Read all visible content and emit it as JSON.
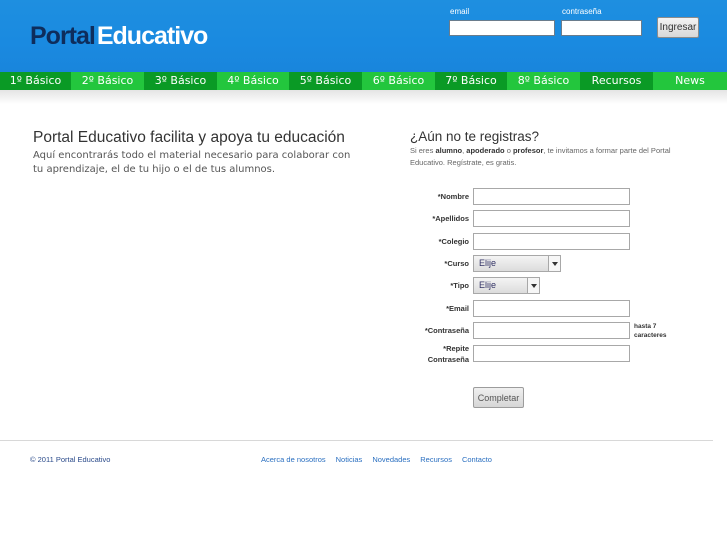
{
  "header": {
    "logo_part1": "Portal",
    "logo_part2": "Educativo",
    "email_label": "email",
    "password_label": "contraseña",
    "login_button": "Ingresar"
  },
  "nav": {
    "items": [
      {
        "label": "1º Básico"
      },
      {
        "label": "2º Básico"
      },
      {
        "label": "3º Básico"
      },
      {
        "label": "4º Básico"
      },
      {
        "label": "5º Básico"
      },
      {
        "label": "6º Básico"
      },
      {
        "label": "7º Básico"
      },
      {
        "label": "8º Básico"
      },
      {
        "label": "Recursos"
      },
      {
        "label": "News"
      }
    ]
  },
  "intro": {
    "title": "Portal Educativo facilita y apoya tu educación",
    "text": "Aquí encontrarás todo el material necesario para colaborar con tu aprendizaje, el de tu hijo o el de tus alumnos."
  },
  "register": {
    "title": "¿Aún no te registras?",
    "text_prefix": "Si eres ",
    "role1": "alumno",
    "sep1": ", ",
    "role2": "apoderado",
    "sep2": " o ",
    "role3": "profesor",
    "text_suffix": ", te invitamos a formar parte del Portal Educativo. Regístrate, es gratis.",
    "fields": {
      "nombre": "*Nombre",
      "apellidos": "*Apellidos",
      "colegio": "*Colegio",
      "curso": "*Curso",
      "tipo": "*Tipo",
      "email": "*Email",
      "contrasena": "*Contraseña",
      "repite": "*Repite Contraseña"
    },
    "curso_value": "Elije",
    "tipo_value": "Elije",
    "password_hint": "hasta 7 caracteres",
    "submit": "Completar"
  },
  "footer": {
    "copyright": "© 2011 Portal Educativo",
    "links": [
      "Acerca de nosotros",
      "Noticias",
      "Novedades",
      "Recursos",
      "Contacto"
    ]
  },
  "colors": {
    "header_blue": "#1a8ae0",
    "nav_green_light": "#23c63d",
    "nav_green_dark": "#0a9a25",
    "logo_dark": "#0e2d5c"
  }
}
